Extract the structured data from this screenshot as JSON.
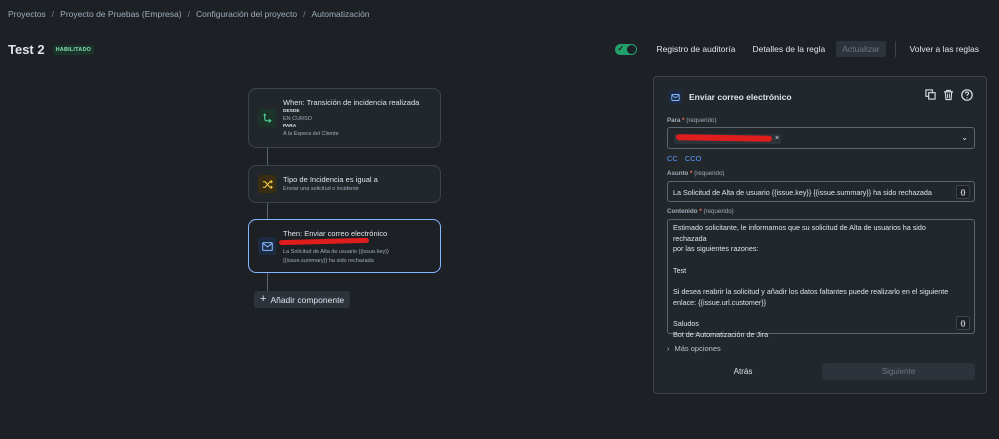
{
  "breadcrumb": [
    "Proyectos",
    "Proyecto de Pruebas (Empresa)",
    "Configuración del proyecto",
    "Automatización"
  ],
  "rule": {
    "title": "Test 2",
    "status": "HABILITADO"
  },
  "toolbar": {
    "audit": "Registro de auditoría",
    "details": "Detalles de la regla",
    "update": "Actualizar",
    "back_rules": "Volver a las reglas"
  },
  "flow": {
    "trigger": {
      "title": "When: Transición de incidencia realizada",
      "from_label": "DESDE",
      "from_value": "EN CURSO",
      "to_label": "PARA",
      "to_value": "A la Espera del Cliente"
    },
    "condition": {
      "title": "Tipo de Incidencia es igual a",
      "value": "Enviar una solicitud o incidente"
    },
    "action": {
      "title": "Then: Enviar correo electrónico",
      "line2": "La Solicitud de Alta de usuario {{issue.key}}",
      "line3": "{{issue.summary}} ha sido rechazada"
    },
    "add_component": "Añadir componente"
  },
  "panel": {
    "title": "Enviar correo electrónico",
    "to_label": "Para",
    "required_hint": "(requerido)",
    "cc": "CC",
    "cco": "CCO",
    "subject_label": "Asunto",
    "subject_value": "La Solicitud de Alta de usuario {{issue.key}} {{issue.summary}} ha sido rechazada",
    "content_label": "Contenido",
    "content_lines": [
      "Estimado solicitante, le informamos que su solicitud de Alta de usuarios ha sido rechazada",
      "por las siguientes razones:",
      "",
      "Test",
      "",
      "Si desea reabrir la solicitud y añadir los datos faltantes puede realizarlo en el siguiente",
      "enlace: {{issue.url.customer}}",
      "",
      "Saludos",
      "Bot de Automatización de Jira"
    ],
    "more_options": "Más opciones",
    "back": "Atrás",
    "next": "Siguiente"
  },
  "colors": {
    "accent": "#579dff",
    "enabled": "#22a06b",
    "redaction": "#e01d1d"
  }
}
